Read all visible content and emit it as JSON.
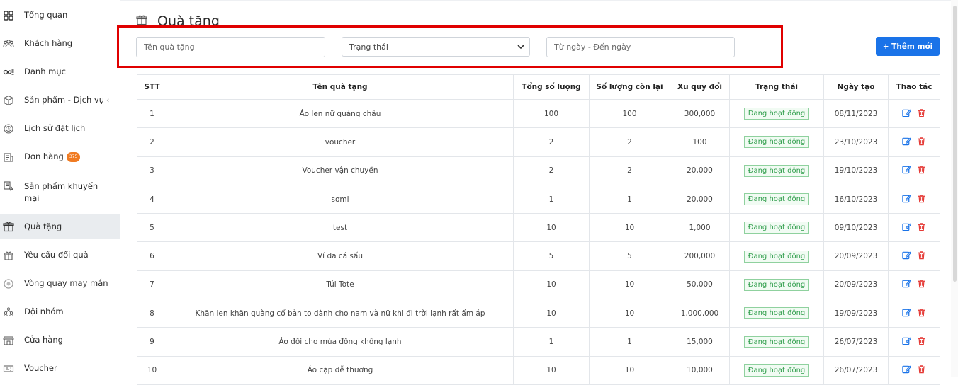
{
  "sidebar": {
    "items": [
      {
        "label": "Tổng quan",
        "icon": "grid-icon"
      },
      {
        "label": "Khách hàng",
        "icon": "users-icon"
      },
      {
        "label": "Danh mục",
        "icon": "category-icon"
      },
      {
        "label": "Sản phẩm - Dịch vụ",
        "icon": "box-icon",
        "chevron": "‹"
      },
      {
        "label": "Lịch sử đặt lịch",
        "icon": "history-icon"
      },
      {
        "label": "Đơn hàng",
        "icon": "order-icon",
        "badge": "375"
      },
      {
        "label": "Sản phẩm khuyến mại",
        "icon": "promo-icon"
      },
      {
        "label": "Quà tặng",
        "icon": "gift-icon",
        "active": true
      },
      {
        "label": "Yêu cầu đổi quà",
        "icon": "exchange-icon"
      },
      {
        "label": "Vòng quay may mắn",
        "icon": "wheel-icon"
      },
      {
        "label": "Đội nhóm",
        "icon": "team-icon"
      },
      {
        "label": "Cửa hàng",
        "icon": "store-icon"
      },
      {
        "label": "Voucher",
        "icon": "voucher-icon"
      }
    ]
  },
  "page": {
    "title": "Quà tặng",
    "icon": "gift-icon"
  },
  "filters": {
    "name_placeholder": "Tên quà tặng",
    "status_value": "Trạng thái",
    "date_placeholder": "Từ ngày - Đến ngày"
  },
  "add_button": {
    "label": "+ Thêm mới"
  },
  "colors": {
    "accent": "#1a73e8",
    "highlight": "#e00000",
    "status_green": "#2e9d4a",
    "delete_red": "#e53935"
  },
  "table": {
    "headers": [
      "STT",
      "Tên quà tặng",
      "Tổng số lượng",
      "Số lượng còn lại",
      "Xu quy đổi",
      "Trạng thái",
      "Ngày tạo",
      "Thao tác"
    ],
    "rows": [
      {
        "stt": "1",
        "name": "Áo len nữ quảng châu",
        "total": "100",
        "remaining": "100",
        "xu": "300,000",
        "status": "Đang hoạt động",
        "date": "08/11/2023"
      },
      {
        "stt": "2",
        "name": "voucher",
        "total": "2",
        "remaining": "2",
        "xu": "100",
        "status": "Đang hoạt động",
        "date": "23/10/2023"
      },
      {
        "stt": "3",
        "name": "Voucher vận chuyển",
        "total": "2",
        "remaining": "2",
        "xu": "20,000",
        "status": "Đang hoạt động",
        "date": "19/10/2023"
      },
      {
        "stt": "4",
        "name": "sơmi",
        "total": "1",
        "remaining": "1",
        "xu": "20,000",
        "status": "Đang hoạt động",
        "date": "16/10/2023"
      },
      {
        "stt": "5",
        "name": "test",
        "total": "10",
        "remaining": "10",
        "xu": "1,000",
        "status": "Đang hoạt động",
        "date": "09/10/2023"
      },
      {
        "stt": "6",
        "name": "Ví da cá sấu",
        "total": "5",
        "remaining": "5",
        "xu": "200,000",
        "status": "Đang hoạt động",
        "date": "20/09/2023"
      },
      {
        "stt": "7",
        "name": "Túi Tote",
        "total": "10",
        "remaining": "10",
        "xu": "50,000",
        "status": "Đang hoạt động",
        "date": "20/09/2023"
      },
      {
        "stt": "8",
        "name": "Khăn len khăn quàng cổ bản to dành cho nam và nữ khi đi trời lạnh rất ấm áp",
        "total": "10",
        "remaining": "10",
        "xu": "1,000,000",
        "status": "Đang hoạt động",
        "date": "19/09/2023"
      },
      {
        "stt": "9",
        "name": "Áo đôi cho mùa đông không lạnh",
        "total": "1",
        "remaining": "1",
        "xu": "15,000",
        "status": "Đang hoạt động",
        "date": "26/07/2023"
      },
      {
        "stt": "10",
        "name": "Áo cặp dễ thương",
        "total": "10",
        "remaining": "10",
        "xu": "10,000",
        "status": "Đang hoạt động",
        "date": "26/07/2023"
      }
    ]
  }
}
